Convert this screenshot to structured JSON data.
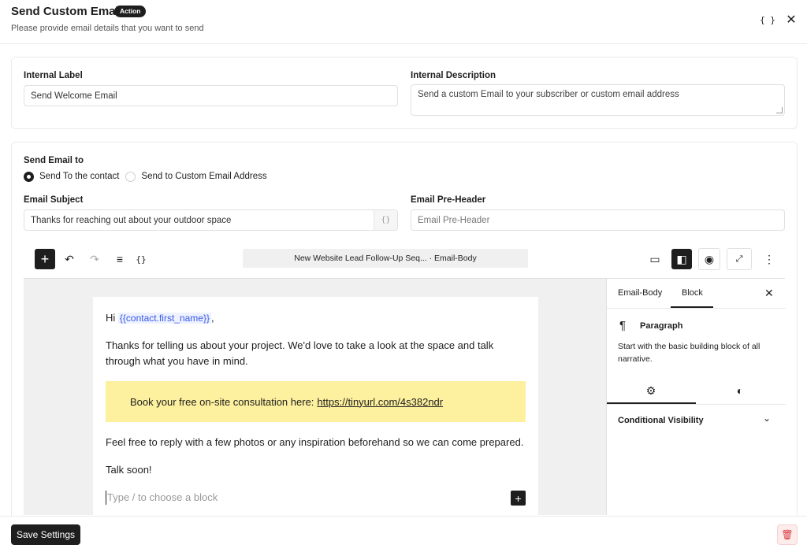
{
  "header": {
    "title": "Send Custom Email",
    "badge": "Action",
    "subtitle": "Please provide email details that you want to send",
    "code_icon": "{ }",
    "close_icon": "✕"
  },
  "general": {
    "internal_label": {
      "label": "Internal Label",
      "value": "Send Welcome Email"
    },
    "internal_description": {
      "label": "Internal Description",
      "value": "Send a custom Email to your subscriber or custom email address"
    }
  },
  "email": {
    "send_to_label": "Send Email to",
    "send_to_options": [
      {
        "label": "Send To the contact",
        "checked": true
      },
      {
        "label": "Send to Custom Email Address",
        "checked": false
      }
    ],
    "subject": {
      "label": "Email Subject",
      "value": "Thanks for reaching out about your outdoor space",
      "suffix": "{}"
    },
    "preheader": {
      "label": "Email Pre-Header",
      "placeholder": "Email Pre-Header"
    }
  },
  "editor": {
    "toolbar": {
      "add": "+",
      "undo": "↶",
      "redo": "↷",
      "list": "≡",
      "code": "{}",
      "document_title": "New Website Lead Follow-Up Seq... · Email-Body",
      "desktop": "▭",
      "sidebar": "◧",
      "preview": "◉",
      "fullscreen": "⤢",
      "more": "⋮"
    },
    "content": {
      "greeting_prefix": "Hi",
      "merge_tag": "{{contact.first_name}}",
      "greeting_suffix": ",",
      "para1": "Thanks for telling us about your project. We'd love to take a look at the space and talk through what you have in mind.",
      "callout_text": "Book your free on-site consultation here:",
      "callout_link": "https://tinyurl.com/4s382ndr",
      "para2": "Feel free to reply with a few photos or any inspiration beforehand so we can come prepared.",
      "para3": "Talk soon!",
      "block_placeholder": "Type / to choose a block",
      "inline_add": "+"
    },
    "sidebar": {
      "tabs": [
        "Email-Body",
        "Block"
      ],
      "active_tab": "Block",
      "close": "✕",
      "block_icon": "¶",
      "block_title": "Paragraph",
      "block_description": "Start with the basic building block of all narrative.",
      "settings_icon": "⚙",
      "styles_icon": "◐",
      "conditional_visibility": "Conditional Visibility",
      "chevron": "⌄"
    }
  },
  "footer": {
    "save_label": "Save Settings",
    "trash_icon": "🗑"
  }
}
